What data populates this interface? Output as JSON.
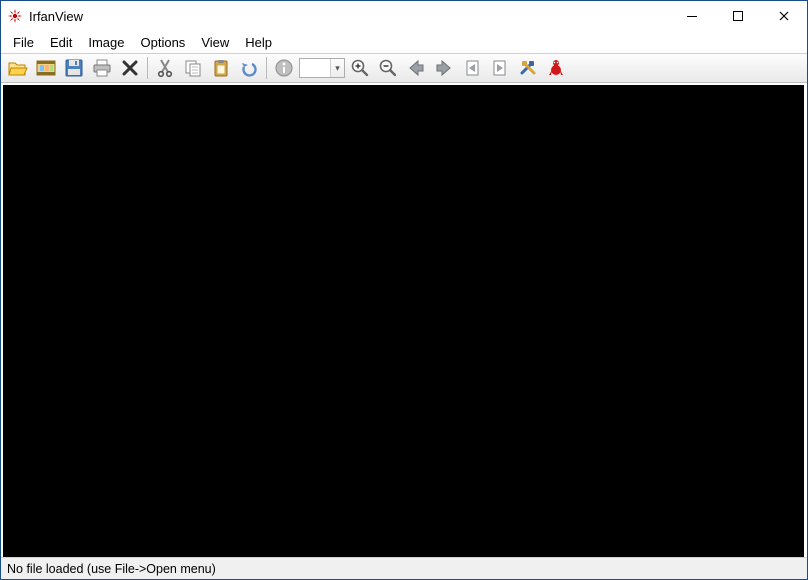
{
  "titlebar": {
    "title": "IrfanView"
  },
  "menu": {
    "items": [
      "File",
      "Edit",
      "Image",
      "Options",
      "View",
      "Help"
    ]
  },
  "toolbar": {
    "zoom_value": "",
    "icons": {
      "open": "open-icon",
      "slideshow": "slideshow-icon",
      "save": "save-icon",
      "print": "print-icon",
      "delete": "delete-icon",
      "cut": "cut-icon",
      "copy": "copy-icon",
      "paste": "paste-icon",
      "undo": "undo-icon",
      "info": "info-icon",
      "zoom_in": "zoom-in-icon",
      "zoom_out": "zoom-out-icon",
      "prev": "previous-icon",
      "next": "next-icon",
      "prev_page": "previous-page-icon",
      "next_page": "next-page-icon",
      "settings": "settings-icon",
      "about": "about-icon"
    }
  },
  "statusbar": {
    "text": "No file loaded (use File->Open menu)"
  }
}
